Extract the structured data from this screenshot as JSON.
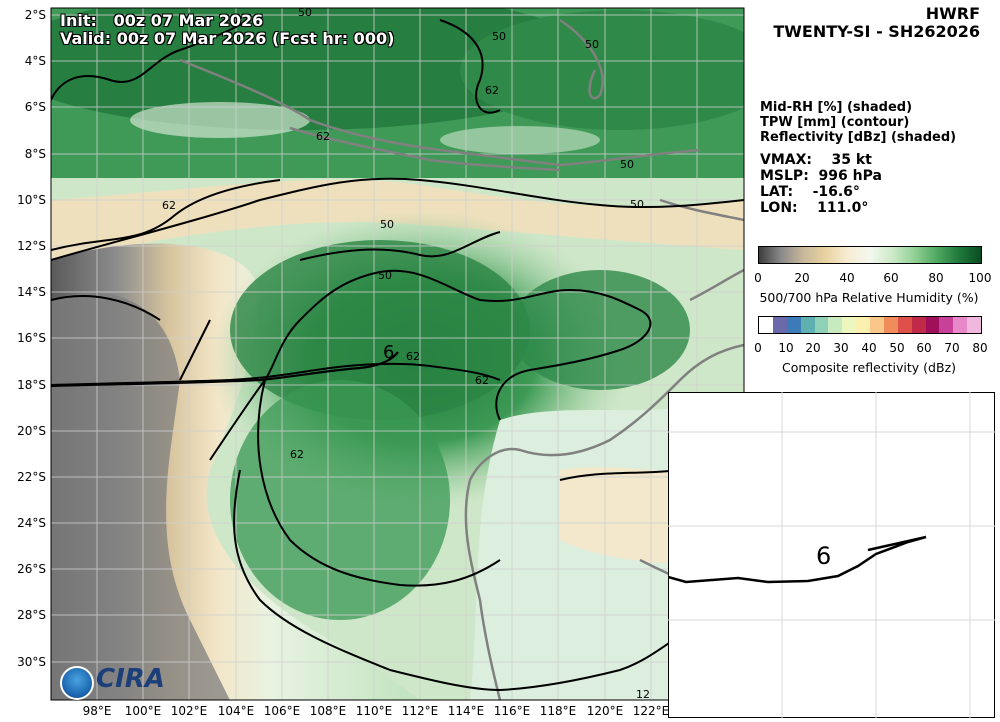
{
  "header": {
    "init_label": "Init:",
    "init_value": "00z 07 Mar 2026",
    "valid_line": "Valid: 00z 07 Mar 2026 (Fcst hr: 000)"
  },
  "title": {
    "model": "HWRF",
    "storm": "TWENTY-SI - SH262026"
  },
  "legend": {
    "fields": [
      "Mid-RH [%] (shaded)",
      "TPW [mm] (contour)",
      "Reflectivity [dBz] (shaded)"
    ],
    "vmax_label": "VMAX:",
    "vmax_value": "35 kt",
    "mslp_label": "MSLP:",
    "mslp_value": "996 hPa",
    "lat_label": "LAT:",
    "lat_value": "-16.6°",
    "lon_label": "LON:",
    "lon_value": "111.0°"
  },
  "colorbar_rh": {
    "ticks": [
      "0",
      "20",
      "40",
      "60",
      "80",
      "100"
    ],
    "label": "500/700 hPa Relative Humidity (%)",
    "colors": [
      "#3d3d3d",
      "#8a8a8a",
      "#c9b89a",
      "#e8d2a0",
      "#f7ecd3",
      "#f3f8ef",
      "#cdeac9",
      "#92d196",
      "#4fa961",
      "#1f7a3c",
      "#0a4d22"
    ]
  },
  "colorbar_ref": {
    "ticks": [
      "0",
      "10",
      "20",
      "30",
      "40",
      "50",
      "60",
      "70",
      "80"
    ],
    "label": "Composite reflectivity (dBz)",
    "colors": [
      "#ffffff",
      "#6a6aaa",
      "#3d7ab8",
      "#5fb0b0",
      "#8fd0b8",
      "#c8eac0",
      "#eef6c0",
      "#fbf0b0",
      "#f9c78a",
      "#f08c5a",
      "#e0504a",
      "#c02a48",
      "#a0105a",
      "#c8409a",
      "#e888c8",
      "#f0b8dc"
    ]
  },
  "map": {
    "lat_labels": [
      "2°S",
      "4°S",
      "6°S",
      "8°S",
      "10°S",
      "12°S",
      "14°S",
      "16°S",
      "18°S",
      "20°S",
      "22°S",
      "24°S",
      "26°S",
      "28°S",
      "30°S"
    ],
    "lon_labels": [
      "98°E",
      "100°E",
      "102°E",
      "104°E",
      "106°E",
      "108°E",
      "110°E",
      "112°E",
      "114°E",
      "116°E",
      "118°E",
      "120°E",
      "122°E"
    ],
    "contour_labels": [
      "50",
      "50",
      "50",
      "62",
      "50",
      "50",
      "62",
      "62",
      "50",
      "50",
      "62",
      "62",
      "62",
      "12"
    ],
    "storm_symbol": "6",
    "logo": "CIRA"
  },
  "inset": {
    "storm_symbol": "6"
  }
}
